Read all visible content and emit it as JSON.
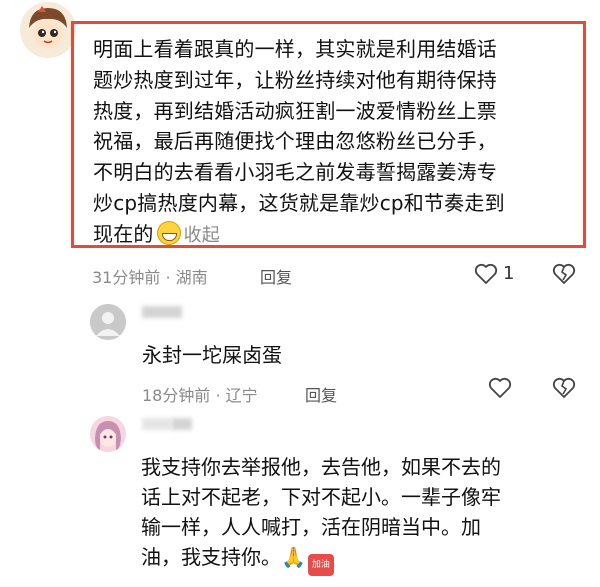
{
  "comments": [
    {
      "lines": [
        "明面上看着跟真的一样，其实就是利用结婚话",
        "题炒热度到过年，让粉丝持续对他有期待保持",
        "热度，再到结婚活动疯狂割一波爱情粉丝上票",
        "祝福，最后再随便找个理由忽悠粉丝已分手，",
        "不明白的去看看小羽毛之前发毒誓揭露姜涛专",
        "炒cp搞热度内幕，这货就是靠炒cp和节奏走到",
        "现在的"
      ],
      "collapse_label": "收起",
      "meta": "31分钟前 · 湖南",
      "reply_label": "回复",
      "like_count": "1",
      "highlight_color": "#e24b39"
    },
    {
      "lines": [
        "永封一坨屎卤蛋"
      ],
      "meta": "18分钟前 · 辽宁",
      "reply_label": "回复"
    },
    {
      "lines": [
        "我支持你去举报他，去告他，如果不去的",
        "话上对不起老，下对不起小。一辈子像牢",
        "输一样，人人喊打，活在阴暗当中。加",
        "油，我支持你。"
      ],
      "badge_label": "加油"
    }
  ],
  "icons": {
    "like": "heart-outline-icon",
    "dislike": "broken-heart-icon",
    "emoji": "grinning-face-icon",
    "pray": "folded-hands-icon"
  }
}
